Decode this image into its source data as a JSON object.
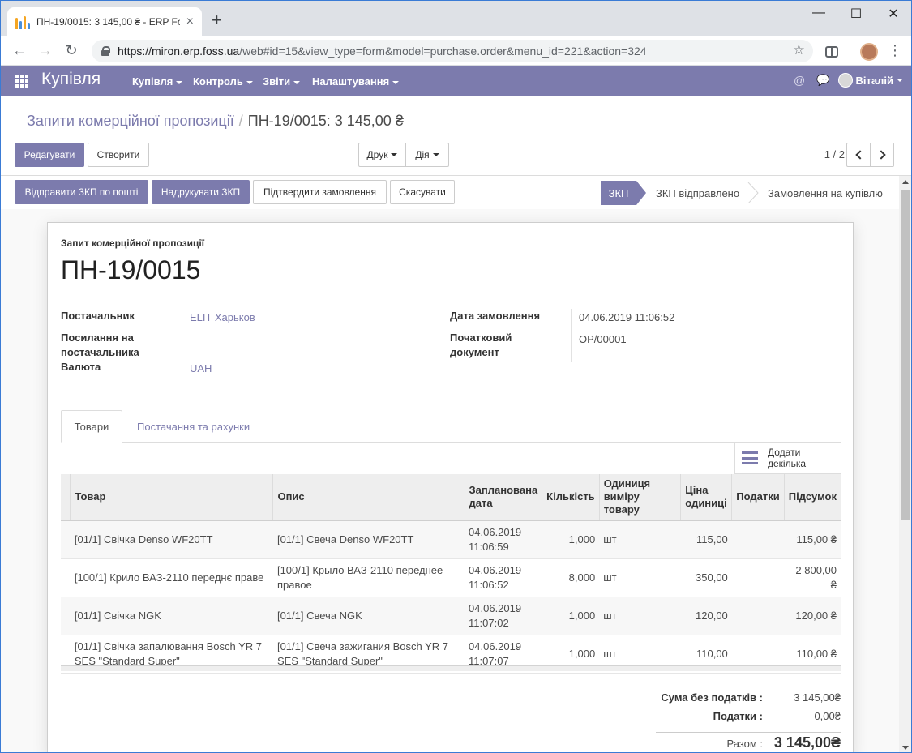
{
  "browser": {
    "tab_title": "ПН-19/0015: 3 145,00 ₴ - ERP Fo",
    "tab_close": "×",
    "new_tab": "+",
    "url_host": "https://miron.erp.foss.ua",
    "url_path": "/web#id=15&view_type=form&model=purchase.order&menu_id=221&action=324",
    "win_min": "—",
    "win_max": "☐",
    "win_close": "✕",
    "back": "←",
    "forward": "→",
    "reload": "↻",
    "star": "☆",
    "menu_dots": "⋮"
  },
  "navbar": {
    "app_title": "Купівля",
    "menus": [
      {
        "label": "Купівля"
      },
      {
        "label": "Контроль"
      },
      {
        "label": "Звіти"
      },
      {
        "label": "Налаштування"
      }
    ],
    "mention_icon": "@",
    "chat_icon": "💬",
    "user_name": "Віталій",
    "accent": "#7c7bad"
  },
  "breadcrumb": {
    "parent": "Запити комерційної пропозиції",
    "separator": "/",
    "current": "ПН-19/0015: 3 145,00 ₴"
  },
  "buttons": {
    "edit": "Редагувати",
    "create": "Створити",
    "print": "Друк",
    "action": "Дія",
    "send_rfq": "Відправити ЗКП по пошті",
    "print_rfq": "Надрукувати ЗКП",
    "confirm": "Підтвердити замовлення",
    "cancel": "Скасувати"
  },
  "pager": {
    "value": "1 / 2"
  },
  "statusbar": {
    "stages": [
      "ЗКП",
      "ЗКП відправлено",
      "Замовлення на купівлю"
    ],
    "active": "ЗКП"
  },
  "form": {
    "doc_type": "Запит комерційної пропозиції",
    "name": "ПН-19/0015",
    "fields": {
      "vendor_label": "Постачальник",
      "vendor_value": "ELIT Харьков",
      "vendor_ref_label": "Посилання на постачальника",
      "currency_label": "Валюта",
      "currency_value": "UAH",
      "order_date_label": "Дата замовлення",
      "order_date_value": "04.06.2019 11:06:52",
      "source_doc_label": "Початковий документ",
      "source_doc_value": "OP/00001"
    }
  },
  "tabs": {
    "products": "Товари",
    "deliveries": "Постачання та рахунки"
  },
  "add_multiple": "Додати декілька",
  "lines": {
    "headers": {
      "product": "Товар",
      "description": "Опис",
      "date_planned": "Запланована дата",
      "qty": "Кількість",
      "uom": "Одиниця виміру товару",
      "price": "Ціна одиниці",
      "taxes": "Податки",
      "subtotal": "Підсумок"
    },
    "rows": [
      {
        "product": "[01/1] Свічка Denso WF20TT",
        "description": "[01/1] Свеча Denso WF20TT",
        "date_planned": "04.06.2019 11:06:59",
        "qty": "1,000",
        "uom": "шт",
        "price": "115,00",
        "taxes": "",
        "subtotal": "115,00 ₴"
      },
      {
        "product": "[100/1] Крило ВАЗ-2110 переднє праве",
        "description": "[100/1] Крыло ВАЗ-2110 переднее правое",
        "date_planned": "04.06.2019 11:06:52",
        "qty": "8,000",
        "uom": "шт",
        "price": "350,00",
        "taxes": "",
        "subtotal": "2 800,00 ₴"
      },
      {
        "product": "[01/1] Свічка NGK",
        "description": "[01/1] Свеча NGK",
        "date_planned": "04.06.2019 11:07:02",
        "qty": "1,000",
        "uom": "шт",
        "price": "120,00",
        "taxes": "",
        "subtotal": "120,00 ₴"
      },
      {
        "product": "[01/1] Свічка запалювання Bosch YR 7 SES \"Standard Super\"",
        "description": "[01/1] Свеча зажигания Bosch YR 7 SES \"Standard Super\"",
        "date_planned": "04.06.2019 11:07:07",
        "qty": "1,000",
        "uom": "шт",
        "price": "110,00",
        "taxes": "",
        "subtotal": "110,00 ₴"
      }
    ]
  },
  "totals": {
    "untaxed_label": "Сума без податків :",
    "untaxed_value": "3 145,00₴",
    "taxes_label": "Податки :",
    "taxes_value": "0,00₴",
    "total_label": "Разом :",
    "total_value": "3 145,00₴"
  }
}
